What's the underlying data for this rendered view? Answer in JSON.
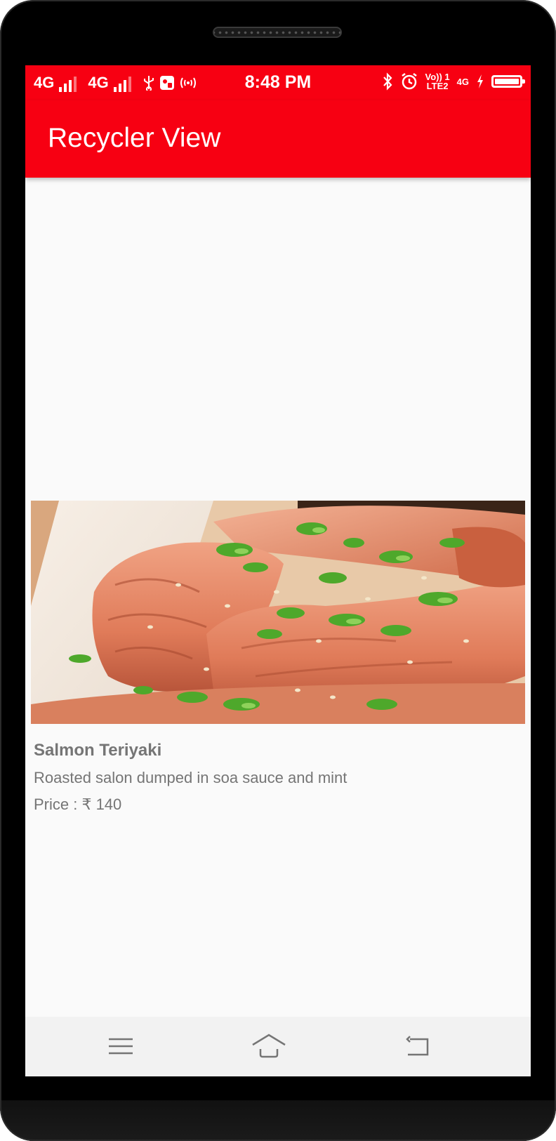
{
  "status_bar": {
    "network_1": "4G",
    "network_2": "4G",
    "time": "8:48 PM",
    "volte_top": "Vo)) 1",
    "volte_bottom": "LTE2",
    "network_3": "4G",
    "battery_level": 1.0
  },
  "app_bar": {
    "title": "Recycler View"
  },
  "item": {
    "title": "Salmon Teriyaki",
    "description": "Roasted salon dumped in soa sauce and mint",
    "price": "Price : ₹ 140"
  },
  "nav": {
    "menu_icon": "menu-icon",
    "home_icon": "home-icon",
    "back_icon": "back-icon"
  },
  "colors": {
    "primary": "#f70012",
    "text_secondary": "#757575",
    "background": "#fafafa"
  }
}
